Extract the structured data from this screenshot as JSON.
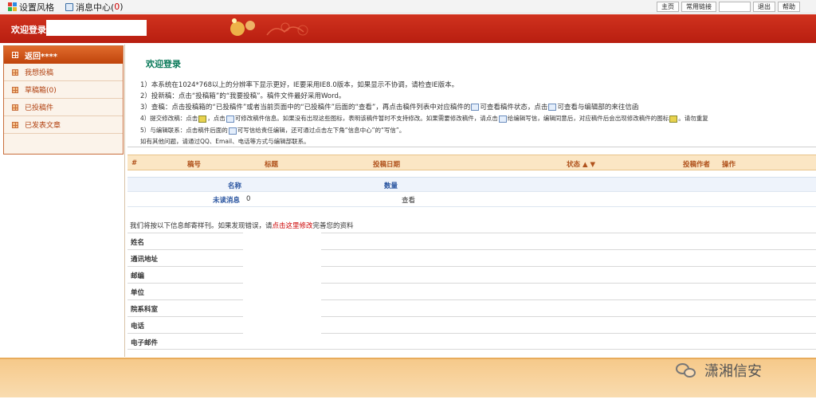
{
  "topbar": {
    "style_label": "设置风格",
    "message_center_label": "消息中心(",
    "message_count": "0",
    "message_close": ")",
    "buttons": [
      "主页",
      "常用链接",
      "退出",
      "帮助"
    ]
  },
  "header": {
    "welcome": "欢迎登录"
  },
  "sidebar": {
    "back": "返回****",
    "items": [
      "我想投稿",
      "草稿箱(0)",
      "已投稿件",
      "已发表文章"
    ]
  },
  "main": {
    "title": "欢迎登录",
    "instructions": {
      "l1": "1）本系统在1024*768以上的分辨率下显示更好，IE要采用IE8.0版本，如果显示不协调，请检查IE版本。",
      "l2": "2）投新稿：点击“投稿箱”的“我要投稿”。稿件文件最好采用Word。",
      "l3a": "3）查稿：点击投稿箱的“已投稿件”或者当前页面中的“已投稿件”后面的“查看”，再点击稿件列表中对应稿件的",
      "l3b": "可查看稿件状态，点击",
      "l3c": "可查看与编辑部的来往信函",
      "l4a": "4）提交修改稿：点击",
      "l4b": "，点击",
      "l4c": "可修改稿件信息。如果没有出现这些图标，表明该稿件暂时不支持修改。如果需要修改稿件，请点击",
      "l4d": "给编辑写信，编辑同意后，对应稿件后会出现修改稿件的图标",
      "l4e": "。请勿重复",
      "l5a": "5）与编辑联系：点击稿件后面的",
      "l5b": "可写信给责任编辑，还可通过点击左下角“信息中心”的“写信”。",
      "l6": "如有其他问题，请通过QQ、Email、电话等方式与编辑部联系。"
    }
  },
  "manuscripts_table": {
    "columns": [
      "#",
      "稿号",
      "标题",
      "投稿日期",
      "状态 ▲ ▼",
      "投稿作者",
      "操作"
    ]
  },
  "messages_table": {
    "columns": [
      "名称",
      "数量"
    ],
    "row": {
      "name": "未读消息",
      "count": "0",
      "action": "查看"
    }
  },
  "info": {
    "note_a": "我们将按以下信息邮寄样刊。如果发现错误，请",
    "note_link": "点击这里修改",
    "note_b": "完善您的资料",
    "fields": [
      "姓名",
      "通讯地址",
      "邮编",
      "单位",
      "院系科室",
      "电话",
      "电子邮件"
    ]
  },
  "watermark": "潇湘信安",
  "colors": {
    "header_red": "#c42816",
    "sidebar_orange": "#d85a20",
    "title_green": "#0a7a5a",
    "footer_orange": "#f6c98a"
  }
}
